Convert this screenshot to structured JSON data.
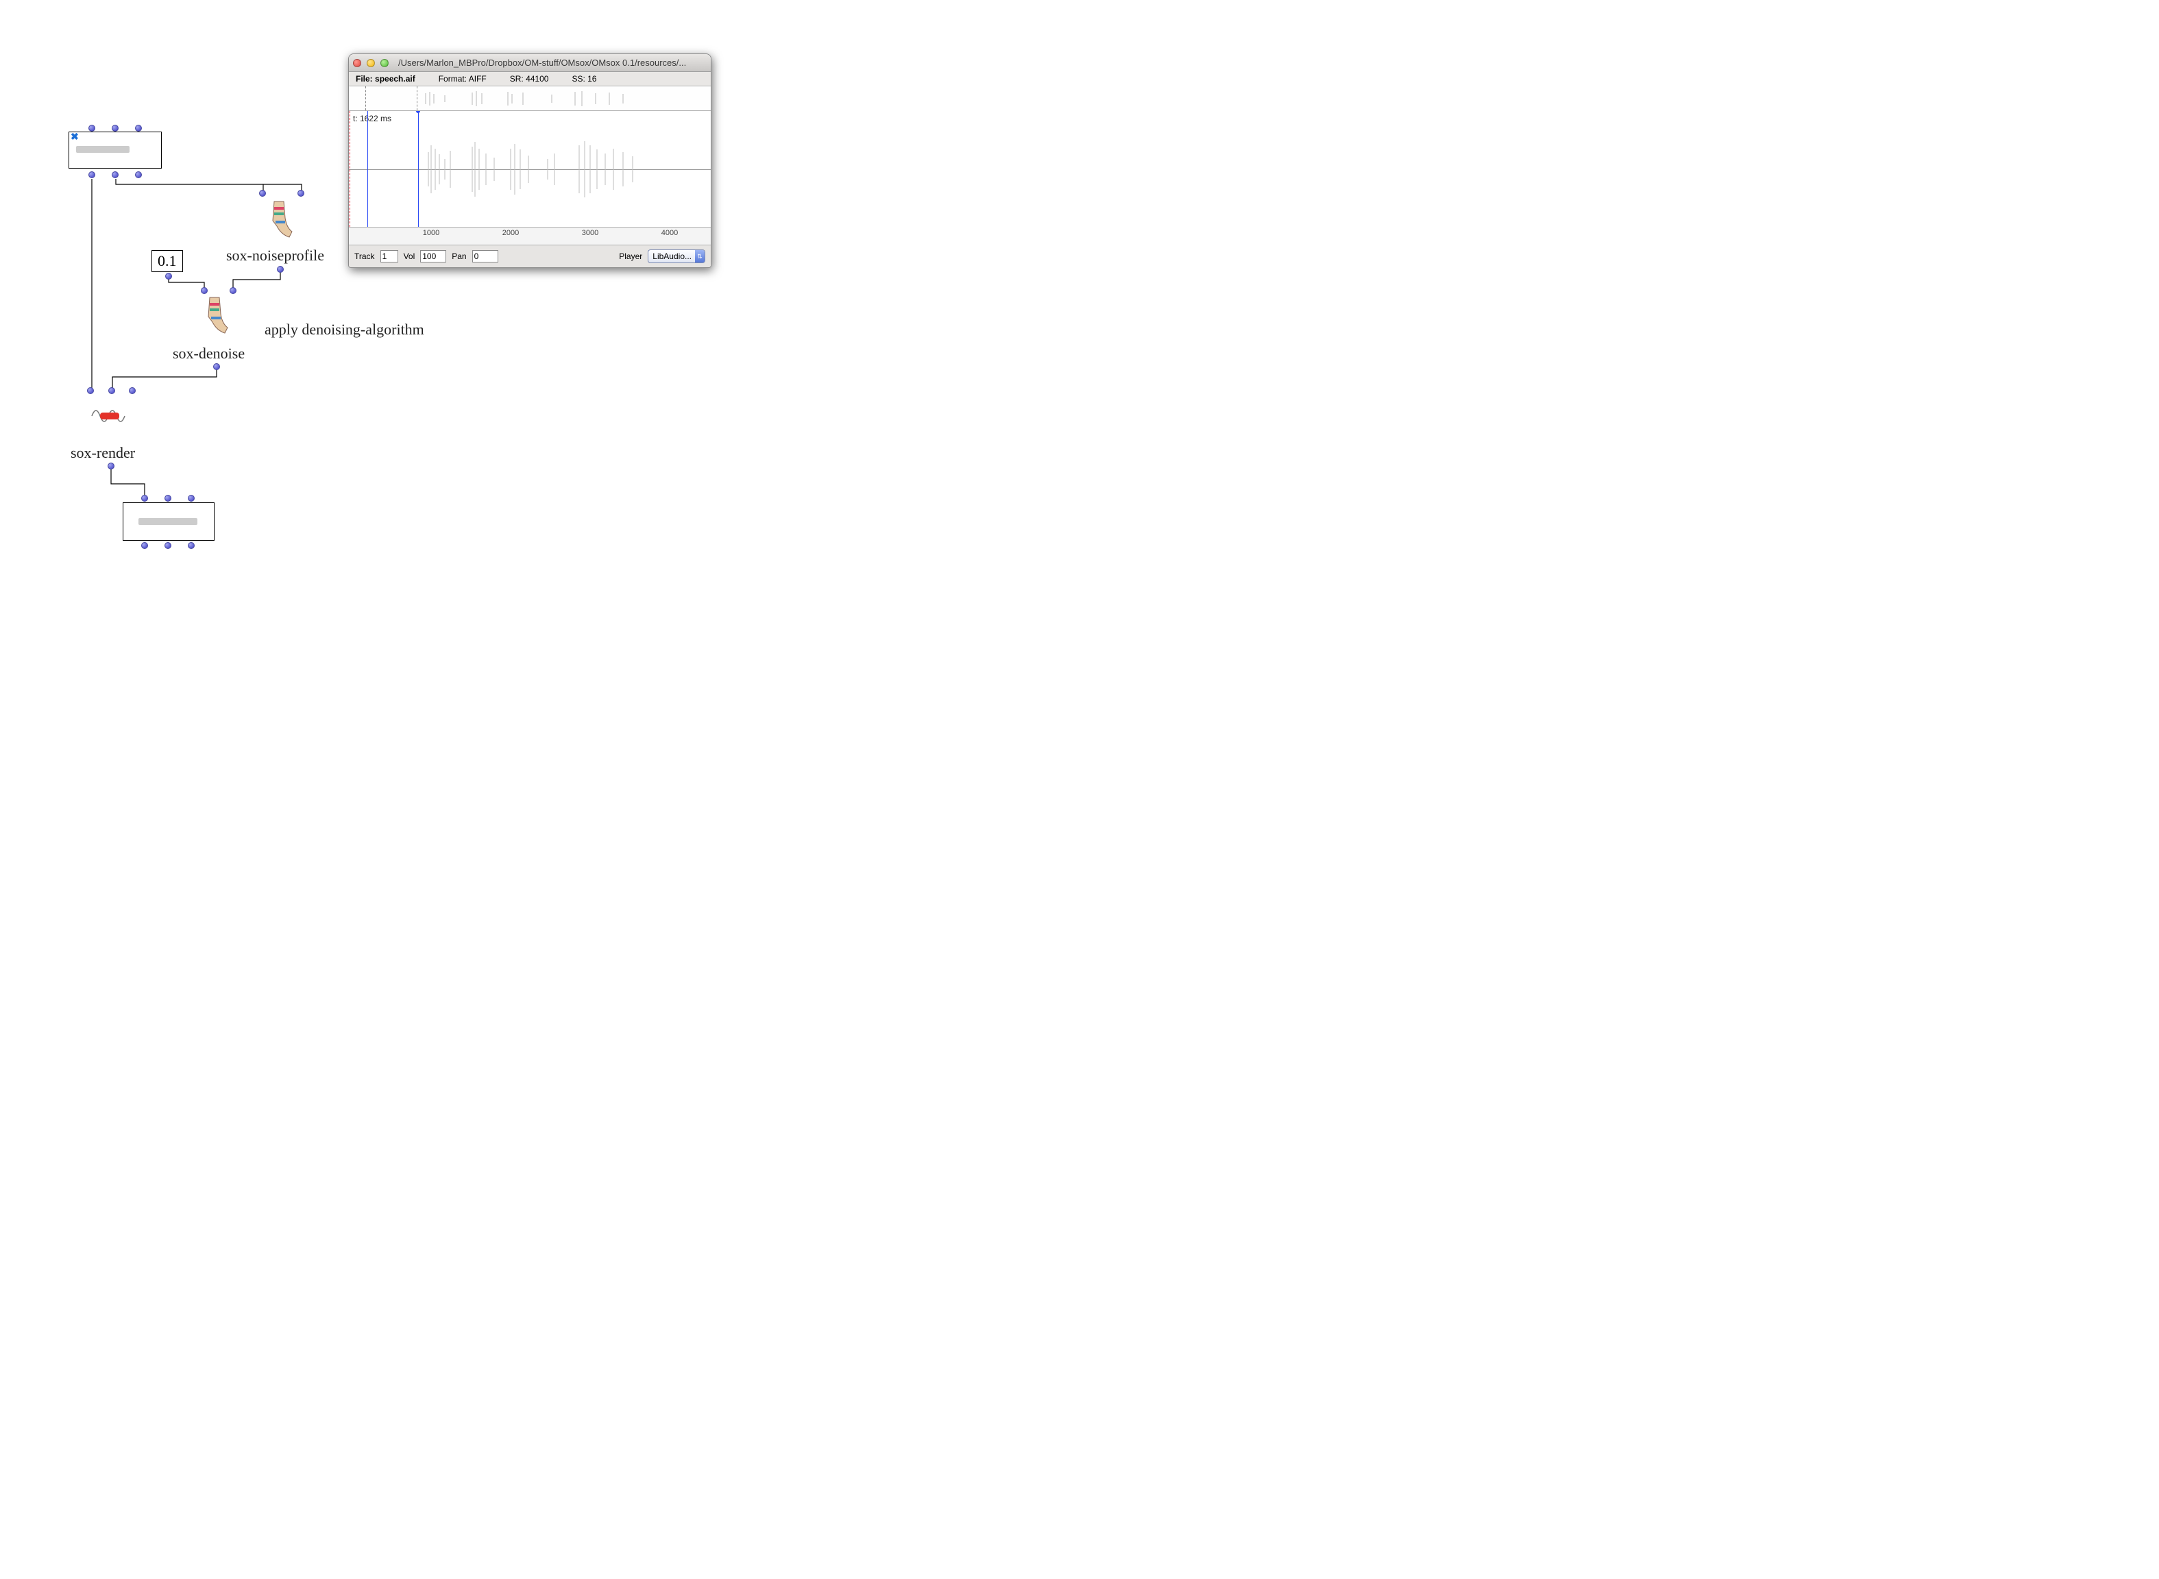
{
  "window": {
    "title": "/Users/Marlon_MBPro/Dropbox/OM-stuff/OMsox/OMsox 0.1/resources/...",
    "file_label": "File: ",
    "file_name": "speech.aif",
    "format": "Format: AIFF",
    "sr": "SR: 44100",
    "ss": "SS: 16",
    "time_cursor": "t: 1622 ms",
    "ruler": {
      "ticks": [
        "1000",
        "2000",
        "3000",
        "4000"
      ]
    },
    "controls": {
      "track_label": "Track",
      "track_value": "1",
      "vol_label": "Vol",
      "vol_value": "100",
      "pan_label": "Pan",
      "pan_value": "0",
      "player_label": "Player",
      "player_value": "LibAudio..."
    }
  },
  "patch": {
    "amount_value": "0.1",
    "noiseprofile_label": "sox-noiseprofile",
    "denoise_label": "sox-denoise",
    "render_label": "sox-render",
    "comment": "apply denoising-algorithm"
  }
}
